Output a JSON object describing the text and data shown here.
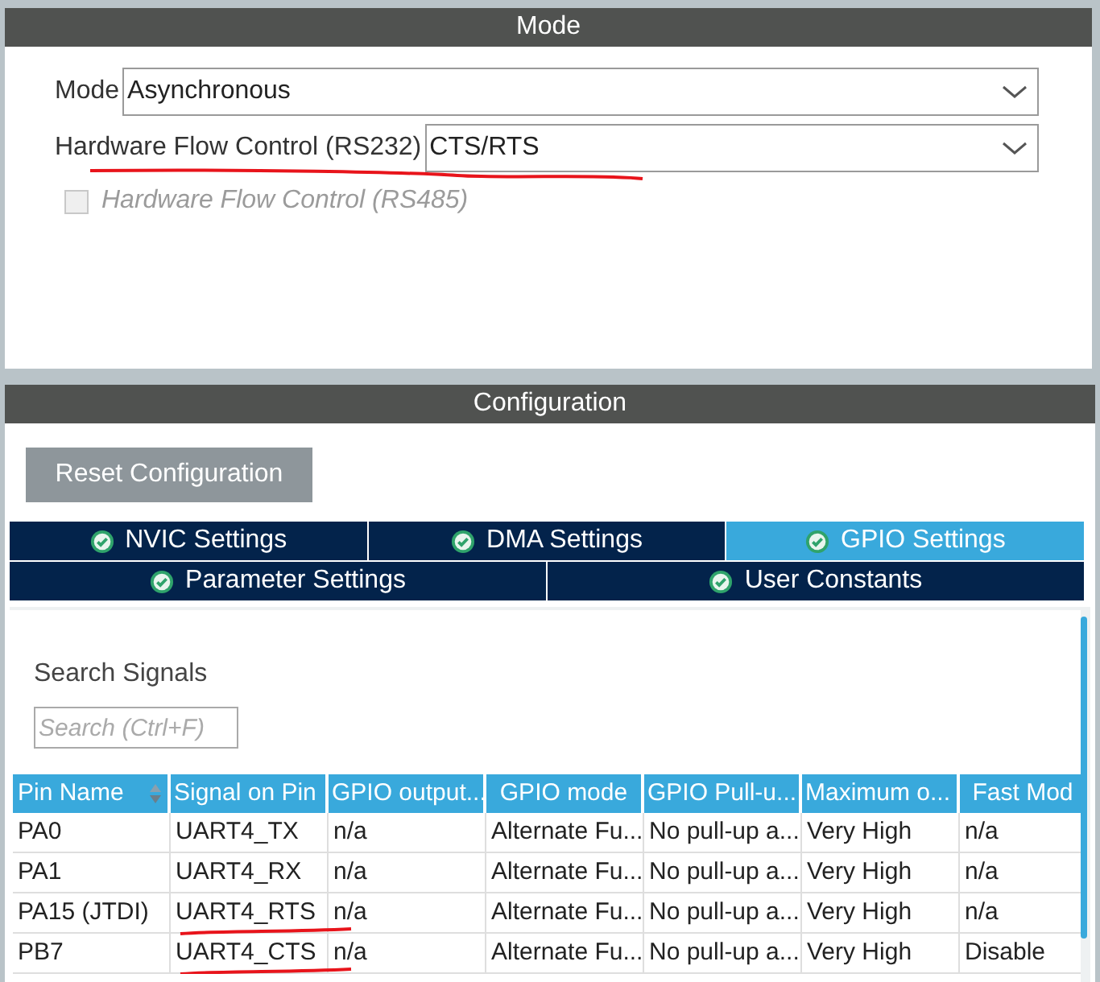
{
  "mode_panel": {
    "title": "Mode",
    "fields": [
      {
        "kind": "select",
        "label": "Mode",
        "value": "Asynchronous",
        "underlined": false
      },
      {
        "kind": "select",
        "label": "Hardware Flow Control (RS232)",
        "value": "CTS/RTS",
        "underlined": true
      },
      {
        "kind": "checkbox",
        "label": "Hardware Flow Control (RS485)",
        "checked": false,
        "disabled": true
      }
    ]
  },
  "config_panel": {
    "title": "Configuration",
    "reset_button": "Reset Configuration",
    "tabs": [
      [
        {
          "label": "NVIC Settings",
          "selected": false
        },
        {
          "label": "DMA Settings",
          "selected": false
        },
        {
          "label": "GPIO Settings",
          "selected": true
        }
      ],
      [
        {
          "label": "Parameter Settings",
          "selected": false
        },
        {
          "label": "User Constants",
          "selected": false
        }
      ]
    ],
    "search": {
      "label": "Search Signals",
      "placeholder": "Search (Ctrl+F)"
    },
    "table": {
      "columns": [
        "Pin Name",
        "Signal on Pin",
        "GPIO output...",
        "GPIO mode",
        "GPIO Pull-u...",
        "Maximum o...",
        "Fast Mod"
      ],
      "rows": [
        {
          "cells": [
            "PA0",
            "UART4_TX",
            "n/a",
            "Alternate Fu...",
            "No pull-up a...",
            "Very High",
            "n/a"
          ],
          "underlined": false
        },
        {
          "cells": [
            "PA1",
            "UART4_RX",
            "n/a",
            "Alternate Fu...",
            "No pull-up a...",
            "Very High",
            "n/a"
          ],
          "underlined": false
        },
        {
          "cells": [
            "PA15 (JTDI)",
            "UART4_RTS",
            "n/a",
            "Alternate Fu...",
            "No pull-up a...",
            "Very High",
            "n/a"
          ],
          "underlined": true
        },
        {
          "cells": [
            "PB7",
            "UART4_CTS",
            "n/a",
            "Alternate Fu...",
            "No pull-up a...",
            "Very High",
            "Disable"
          ],
          "underlined": true
        }
      ]
    }
  }
}
